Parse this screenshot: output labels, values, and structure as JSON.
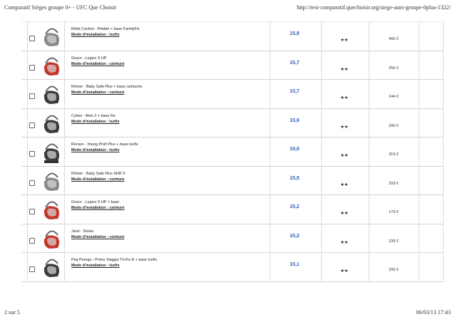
{
  "header": {
    "title": "Comparatif Sièges groupe 0+ - UFC Que Choisir",
    "url": "http://test-comparatif.quechoisir.org/siege-auto-groupe-0plus-1322/"
  },
  "footer": {
    "page": "2 sur 5",
    "datetime": "06/03/13 17:43"
  },
  "rows": [
    {
      "name": "Bébé Confort - Pebble + base FamilyFix",
      "install": "Mode d'installation : Isofix",
      "score": "15,8",
      "stars": "★★",
      "price": "466 €",
      "icon": "car-seat-gray-icon"
    },
    {
      "name": "Graco - Logico S HP",
      "install": "Mode d'installation : ceinturé",
      "score": "15,7",
      "stars": "★★",
      "price": "256 €",
      "icon": "car-seat-red-icon"
    },
    {
      "name": "Römer - Baby Safe Plus + base ceinturée",
      "install": "Mode d'installation : ceinturé",
      "score": "15,7",
      "stars": "★★",
      "price": "244 €",
      "icon": "car-seat-black-icon"
    },
    {
      "name": "Cybex - Aton 2 + base Fix",
      "install": "Mode d'installation : Isofix",
      "score": "15,6",
      "stars": "★★",
      "price": "200 €",
      "icon": "car-seat-black-icon"
    },
    {
      "name": "Recaro - Young Profi Plus + base Isofix",
      "install": "Mode d'installation : Isofix",
      "score": "15,6",
      "stars": "★★",
      "price": "319 €",
      "icon": "car-seat-base-icon"
    },
    {
      "name": "Römer - Baby Safe Plus SHR II",
      "install": "Mode d'installation : ceinturé",
      "score": "15,5",
      "stars": "★★",
      "price": "209 €",
      "icon": "car-seat-gray-icon"
    },
    {
      "name": "Graco - Logico S HP + base",
      "install": "Mode d'installation : ceinturé",
      "score": "15,2",
      "stars": "★★",
      "price": "179 €",
      "icon": "car-seat-red-icon"
    },
    {
      "name": "Jané - Strata",
      "install": "Mode d'installation : ceinturé",
      "score": "15,2",
      "stars": "★★",
      "price": "239 €",
      "icon": "car-seat-red-icon"
    },
    {
      "name": "Peg Perego - Primo Viaggio Tri-Fix K + base Isofix",
      "install": "Mode d'installation : Isofix",
      "score": "15,1",
      "stars": "★★",
      "price": "339 €",
      "icon": "car-seat-black-icon"
    }
  ],
  "colors": {
    "score": "#2d5cc4",
    "seat_gray": "#8a8a8a",
    "seat_red": "#c4352a",
    "seat_black": "#3a3a3a"
  }
}
